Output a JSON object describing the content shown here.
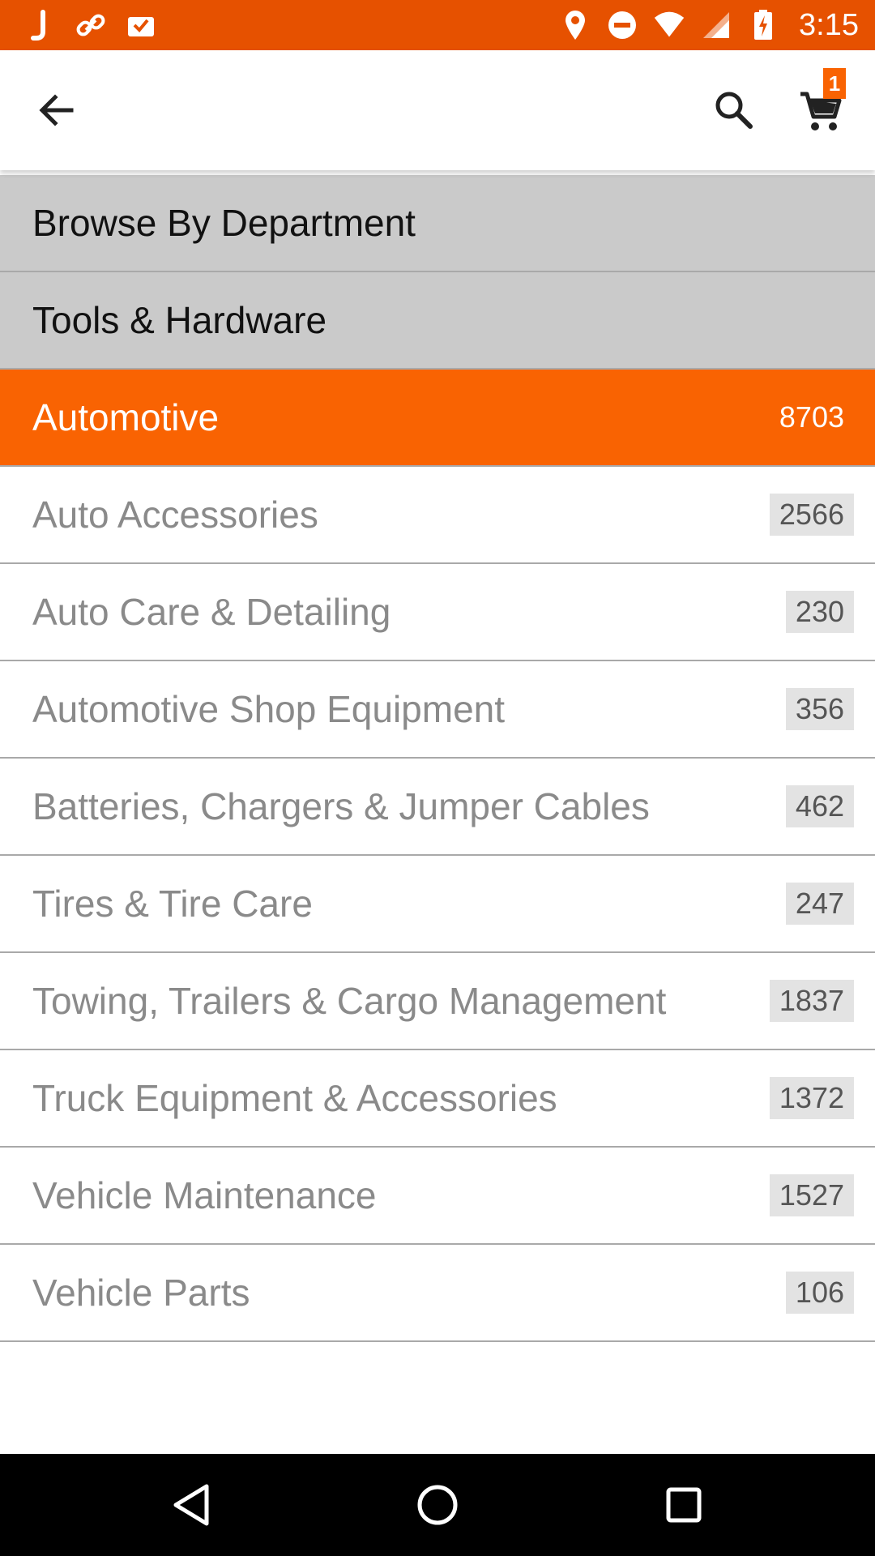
{
  "status_bar": {
    "time": "3:15",
    "background": "#e65100",
    "left_icons": [
      "j-app-icon",
      "link-icon",
      "inbox-check-icon"
    ],
    "right_icons": [
      "location-icon",
      "do-not-disturb-icon",
      "wifi-icon",
      "signal-icon",
      "battery-charging-icon"
    ]
  },
  "app_bar": {
    "icons": [
      "arrow-back-icon",
      "search-icon",
      "cart-icon"
    ],
    "cart_count": "1"
  },
  "breadcrumbs": [
    {
      "label": "Browse By Department"
    },
    {
      "label": "Tools & Hardware"
    }
  ],
  "selected": {
    "label": "Automotive",
    "count": "8703"
  },
  "categories": [
    {
      "label": "Auto Accessories",
      "count": "2566"
    },
    {
      "label": "Auto Care & Detailing",
      "count": "230"
    },
    {
      "label": "Automotive Shop Equipment",
      "count": "356"
    },
    {
      "label": "Batteries, Chargers & Jumper Cables",
      "count": "462"
    },
    {
      "label": "Tires & Tire Care",
      "count": "247"
    },
    {
      "label": "Towing, Trailers & Cargo Management",
      "count": "1837"
    },
    {
      "label": "Truck Equipment & Accessories",
      "count": "1372"
    },
    {
      "label": "Vehicle Maintenance",
      "count": "1527"
    },
    {
      "label": "Vehicle Parts",
      "count": "106"
    }
  ],
  "colors": {
    "accent": "#f96302",
    "breadcrumb_bg": "#cacaca",
    "count_badge_bg": "#e3e3e3"
  },
  "nav_bar": {
    "icons": [
      "back-triangle-icon",
      "home-circle-icon",
      "recents-square-icon"
    ]
  }
}
